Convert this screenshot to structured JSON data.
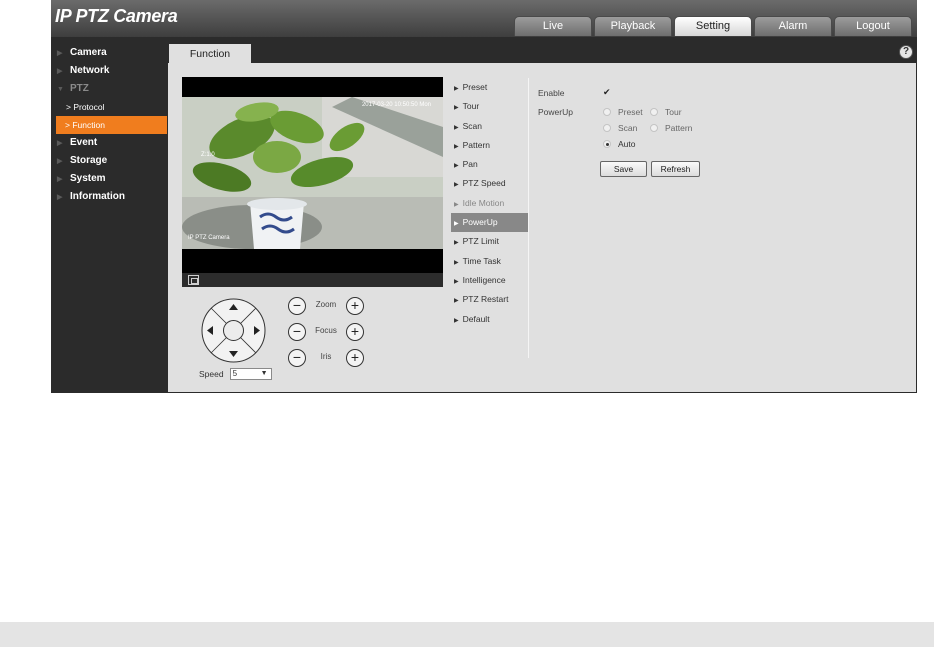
{
  "app": {
    "title": "IP PTZ Camera"
  },
  "nav": {
    "tabs": [
      {
        "label": "Live",
        "active": false
      },
      {
        "label": "Playback",
        "active": false
      },
      {
        "label": "Setting",
        "active": true
      },
      {
        "label": "Alarm",
        "active": false
      },
      {
        "label": "Logout",
        "active": false
      }
    ]
  },
  "sidebar": {
    "camera": "Camera",
    "network": "Network",
    "ptz": "PTZ",
    "protocol": "> Protocol",
    "function": "> Function",
    "event": "Event",
    "storage": "Storage",
    "system": "System",
    "information": "Information"
  },
  "content": {
    "tab_label": "Function",
    "help_icon": "?"
  },
  "video": {
    "timestamp": "2017-03-20 10:50:50 Mon",
    "zoom_overlay": "Z:1.0",
    "camera_label": "IP PTZ Camera"
  },
  "ptz": {
    "speed_label": "Speed",
    "speed_value": "5",
    "zoom_label": "Zoom",
    "focus_label": "Focus",
    "iris_label": "Iris",
    "minus_symbol": "−",
    "plus_symbol": "+"
  },
  "functions": {
    "preset": "Preset",
    "tour": "Tour",
    "scan": "Scan",
    "pattern": "Pattern",
    "pan": "Pan",
    "ptz_speed": "PTZ Speed",
    "idle_motion": "Idle Motion",
    "powerup": "PowerUp",
    "ptz_limit": "PTZ Limit",
    "time_task": "Time Task",
    "intelligence": "Intelligence",
    "ptz_restart": "PTZ Restart",
    "default": "Default"
  },
  "powerup_form": {
    "enable_label": "Enable",
    "enable_checked": true,
    "enable_mark": "✔",
    "powerup_label": "PowerUp",
    "options": {
      "preset": "Preset",
      "tour": "Tour",
      "scan": "Scan",
      "pattern": "Pattern",
      "auto": "Auto"
    },
    "selected": "Auto",
    "save_label": "Save",
    "refresh_label": "Refresh"
  },
  "colors": {
    "accent_orange": "#f07d1e",
    "sidebar_bg": "#2b2b2b",
    "content_bg": "#e0e0e0",
    "active_function_bg": "#888888"
  }
}
